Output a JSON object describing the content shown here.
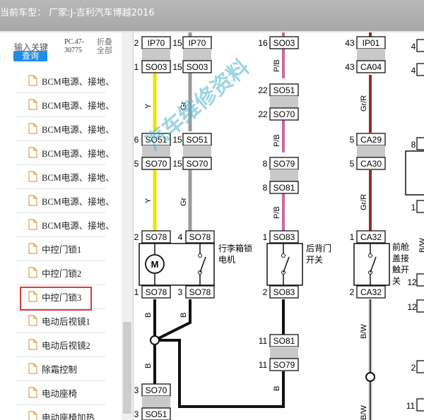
{
  "window": {
    "vehicle_title": "当前车型：  厂家:J-吉利汽车博越2016"
  },
  "search": {
    "keyword_label": "输入关键",
    "query_button": "查询",
    "pc_code_line1": "PC.47-",
    "pc_code_line2": "30775",
    "collapse_line1": "折叠",
    "collapse_line2": "全部"
  },
  "tree": {
    "items": [
      {
        "label": "BCM电源、接地、"
      },
      {
        "label": "BCM电源、接地、"
      },
      {
        "label": "BCM电源、接地、"
      },
      {
        "label": "BCM电源、接地、"
      },
      {
        "label": "BCM电源、接地、"
      },
      {
        "label": "BCM电源、接地、"
      },
      {
        "label": "BCM电源、接地、"
      },
      {
        "label": "中控门锁1"
      },
      {
        "label": "中控门锁2"
      },
      {
        "label": "中控门锁3"
      },
      {
        "label": "电动后视镜1"
      },
      {
        "label": "电动后视镜2"
      },
      {
        "label": "除霜控制"
      },
      {
        "label": "电动座椅"
      },
      {
        "label": "电动座椅加热"
      }
    ],
    "selected_index": 8
  },
  "diagram": {
    "watermark": "汽车维修资料",
    "components": {
      "trunk_motor": [
        "行李箱锁",
        "电机"
      ],
      "tailgate_switch": [
        "后背门",
        "开关"
      ],
      "hood_switch": [
        "前舱",
        "盖接",
        "触开",
        "关"
      ],
      "motor_symbol": "M"
    },
    "connectors": [
      {
        "pin": "2",
        "name": "IP70"
      },
      {
        "pin": "1",
        "name": "SO03"
      },
      {
        "pin": "6",
        "name": "SO51"
      },
      {
        "pin": "5",
        "name": "SO70"
      },
      {
        "pin": "2",
        "name": "SO78"
      },
      {
        "pin": "1",
        "name": "SO78"
      },
      {
        "pin": "3",
        "name": "SO70"
      },
      {
        "pin": "3",
        "name": "SO51"
      },
      {
        "pin": "15",
        "name": "IP70"
      },
      {
        "pin": "15",
        "name": "SO03"
      },
      {
        "pin": "15",
        "name": "SO51"
      },
      {
        "pin": "15",
        "name": "SO70"
      },
      {
        "pin": "4",
        "name": "SO78"
      },
      {
        "pin": "3",
        "name": "SO78"
      },
      {
        "pin": "16",
        "name": "SO03"
      },
      {
        "pin": "22",
        "name": "SO51"
      },
      {
        "pin": "22",
        "name": "SO70"
      },
      {
        "pin": "8",
        "name": "SO79"
      },
      {
        "pin": "8",
        "name": "SO81"
      },
      {
        "pin": "1",
        "name": "SO83"
      },
      {
        "pin": "2",
        "name": "SO83"
      },
      {
        "pin": "11",
        "name": "SO81"
      },
      {
        "pin": "11",
        "name": "SO79"
      },
      {
        "pin": "43",
        "name": "IP01"
      },
      {
        "pin": "43",
        "name": "CA04"
      },
      {
        "pin": "5",
        "name": "CA29"
      },
      {
        "pin": "5",
        "name": "CA30"
      },
      {
        "pin": "1",
        "name": "CA32"
      },
      {
        "pin": "2",
        "name": "CA32"
      }
    ],
    "wire_colors": [
      "Y",
      "Y",
      "B",
      "B",
      "Gr",
      "Gr",
      "B",
      "P/B",
      "P/B",
      "P/B",
      "B",
      "Gr/R",
      "Gr/R",
      "B/W",
      "B/W",
      "B/W"
    ],
    "edge_pins": [
      "4",
      "4",
      "8",
      "1",
      "12",
      "12",
      "2",
      "11"
    ],
    "colors": {
      "yellow": "#f2e200",
      "gray": "#9a9a9a",
      "pink": "#c96aa0",
      "darkred": "#a0281c",
      "black": "#111111",
      "teal": "#4ab3c6"
    }
  }
}
